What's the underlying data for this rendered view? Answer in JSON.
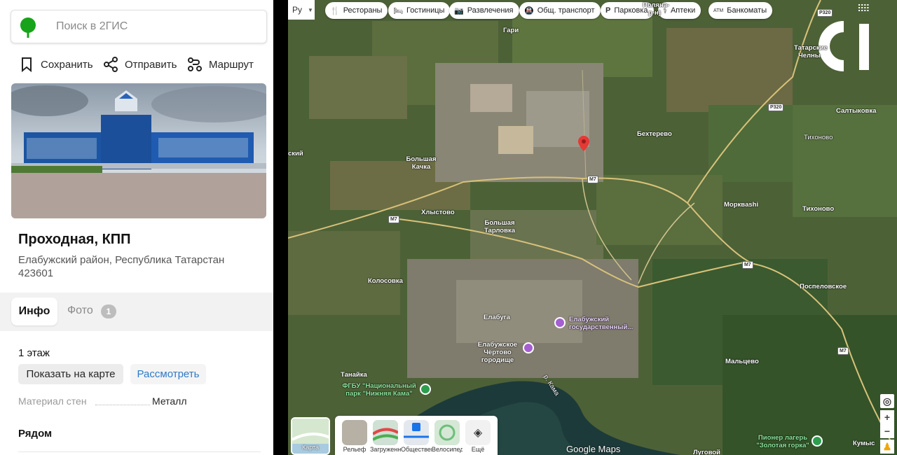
{
  "left_panel": {
    "search_placeholder": "Поиск в 2ГИС",
    "actions": {
      "save": "Сохранить",
      "share": "Отправить",
      "route": "Маршрут"
    },
    "place": {
      "title": "Проходная, КПП",
      "address_line1": "Елабужский район, Республика Татарстан",
      "postcode": "423601"
    },
    "tabs": {
      "info": "Инфо",
      "photo": "Фото",
      "photo_count": "1"
    },
    "floor": "1 этаж",
    "buttons": {
      "show_on_map": "Показать на карте",
      "view": "Рассмотреть"
    },
    "material_label": "Материал стен",
    "material_value": "Металл",
    "nearby_title": "Рядом"
  },
  "map": {
    "lang_selector": "Ру",
    "category_pills": [
      {
        "icon": "restaurant-icon",
        "label": "Рестораны"
      },
      {
        "icon": "hotel-icon",
        "label": "Гостиницы"
      },
      {
        "icon": "camera-icon",
        "label": "Развлечения"
      },
      {
        "icon": "transit-icon",
        "label": "Общ. транспорт"
      },
      {
        "icon": "parking-icon",
        "label": "Парковка"
      },
      {
        "icon": "pharmacy-icon",
        "label": "Аптеки"
      },
      {
        "icon": "atm-icon",
        "label": "Банкоматы"
      }
    ],
    "place_labels": {
      "gari": "Гари",
      "bolshaya_kachka": "Большая Качка",
      "khlystovo": "Хлыстово",
      "bolshaya_tarlovka": "Большая Тарловка",
      "kolosovka": "Колосовка",
      "elabuga": "Елабуга",
      "bekhterevo": "Бехтерево",
      "morkvashi": "Морквashi",
      "tikhonovo": "Тихоново",
      "tikhonovo_stop": "Тихоново",
      "saltykovka": "Салтыковка",
      "pospelovskoe": "Поспеловское",
      "maltsevo": "Мальцево",
      "tanayka": "Танайка",
      "kumys": "Кумыс",
      "lugovoy": "Луговой",
      "kama_river": "р. Кама",
      "tatarskie_chelny": "Татарские Челны",
      "partial_left": "ский",
      "partial_top": "Поляна-р-н)"
    },
    "poi_labels": {
      "university": "Елабужский государственный...",
      "chertovo": "Елабужское Чёртово городище",
      "park": "ФГБУ \"Национальный парк \"Нижняя Кама\"",
      "camp": "Пионер лагерь \"Золотая горка\""
    },
    "road_shields": [
      "М7",
      "М7",
      "М7",
      "М7",
      "Р320",
      "Р320"
    ],
    "bottom_layers": [
      "Рельеф",
      "Загруженность",
      "Общественный транспорт",
      "Велосипед",
      "Ещё"
    ],
    "karta_label": "Карта",
    "branding": "Google Maps"
  }
}
